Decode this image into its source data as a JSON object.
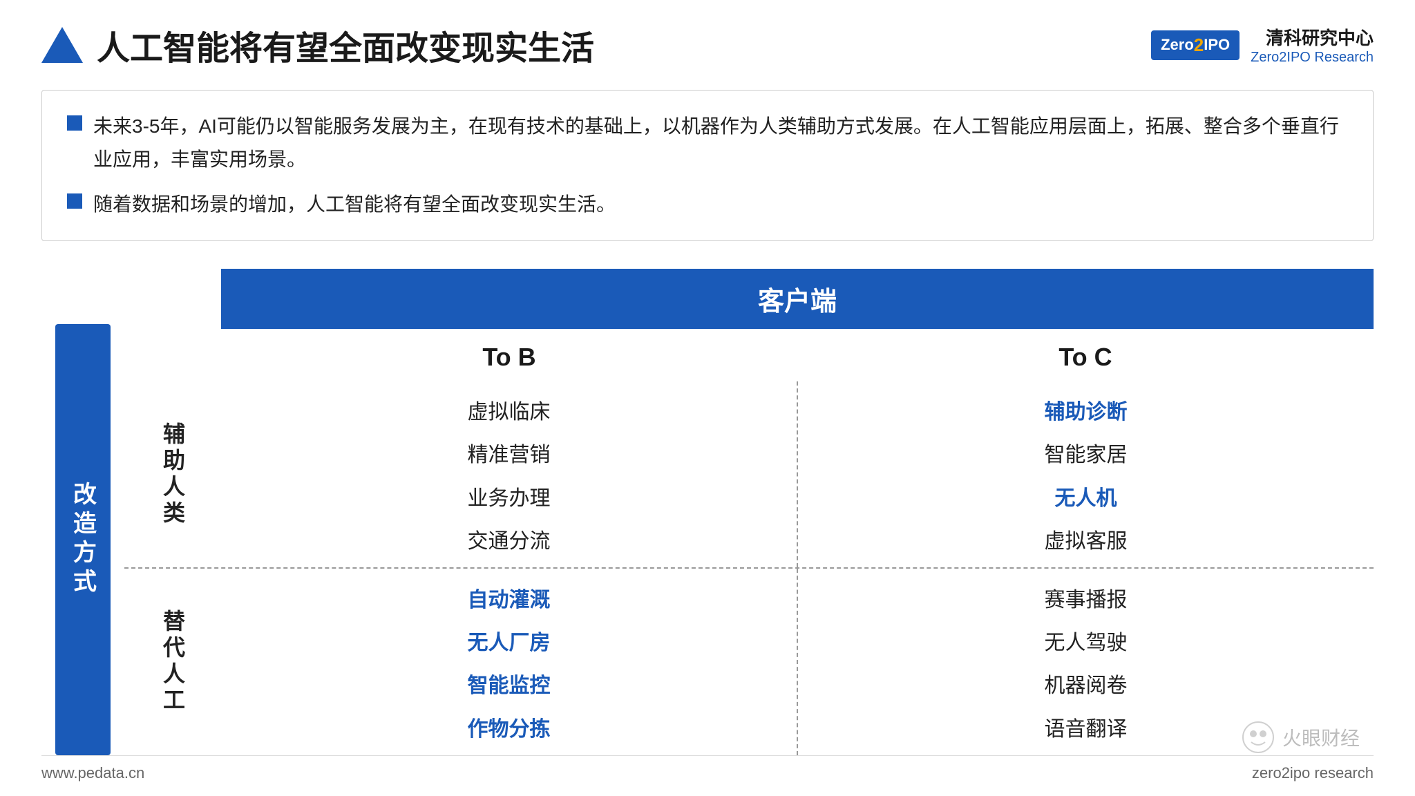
{
  "header": {
    "triangle_label": "▲",
    "title": "人工智能将有望全面改变现实生活",
    "logo_text_cn": "清科研究中心",
    "logo_text_en": "Zero2IPO Research"
  },
  "bullets": [
    {
      "text": "未来3-5年，AI可能仍以智能服务发展为主，在现有技术的基础上，以机器作为人类辅助方式发展。在人工智能应用层面上，拓展、整合多个垂直行业应用，丰富实用场景。"
    },
    {
      "text": "随着数据和场景的增加，人工智能将有望全面改变现实生活。"
    }
  ],
  "diagram": {
    "y_axis_label": "改造方式",
    "top_bar_label": "客户端",
    "col_left_label": "To  B",
    "col_right_label": "To  C",
    "row_top_label": "辅助人类",
    "row_bottom_label": "替代人工",
    "top_left_items": [
      {
        "text": "虚拟临床",
        "blue": false
      },
      {
        "text": "精准营销",
        "blue": false
      },
      {
        "text": "业务办理",
        "blue": false
      },
      {
        "text": "交通分流",
        "blue": false
      }
    ],
    "top_right_items": [
      {
        "text": "辅助诊断",
        "blue": true
      },
      {
        "text": "智能家居",
        "blue": false
      },
      {
        "text": "无人机",
        "blue": true
      },
      {
        "text": "虚拟客服",
        "blue": false
      }
    ],
    "bottom_left_items": [
      {
        "text": "自动灌溉",
        "blue": true
      },
      {
        "text": "无人厂房",
        "blue": true
      },
      {
        "text": "智能监控",
        "blue": true
      },
      {
        "text": "作物分拣",
        "blue": true
      }
    ],
    "bottom_right_items": [
      {
        "text": "赛事播报",
        "blue": false
      },
      {
        "text": "无人驾驶",
        "blue": false
      },
      {
        "text": "机器阅卷",
        "blue": false
      },
      {
        "text": "语音翻译",
        "blue": false
      }
    ]
  },
  "footer": {
    "left": "www.pedata.cn",
    "right": "zero2ipo research"
  },
  "watermark": {
    "text": "火眼财经"
  }
}
